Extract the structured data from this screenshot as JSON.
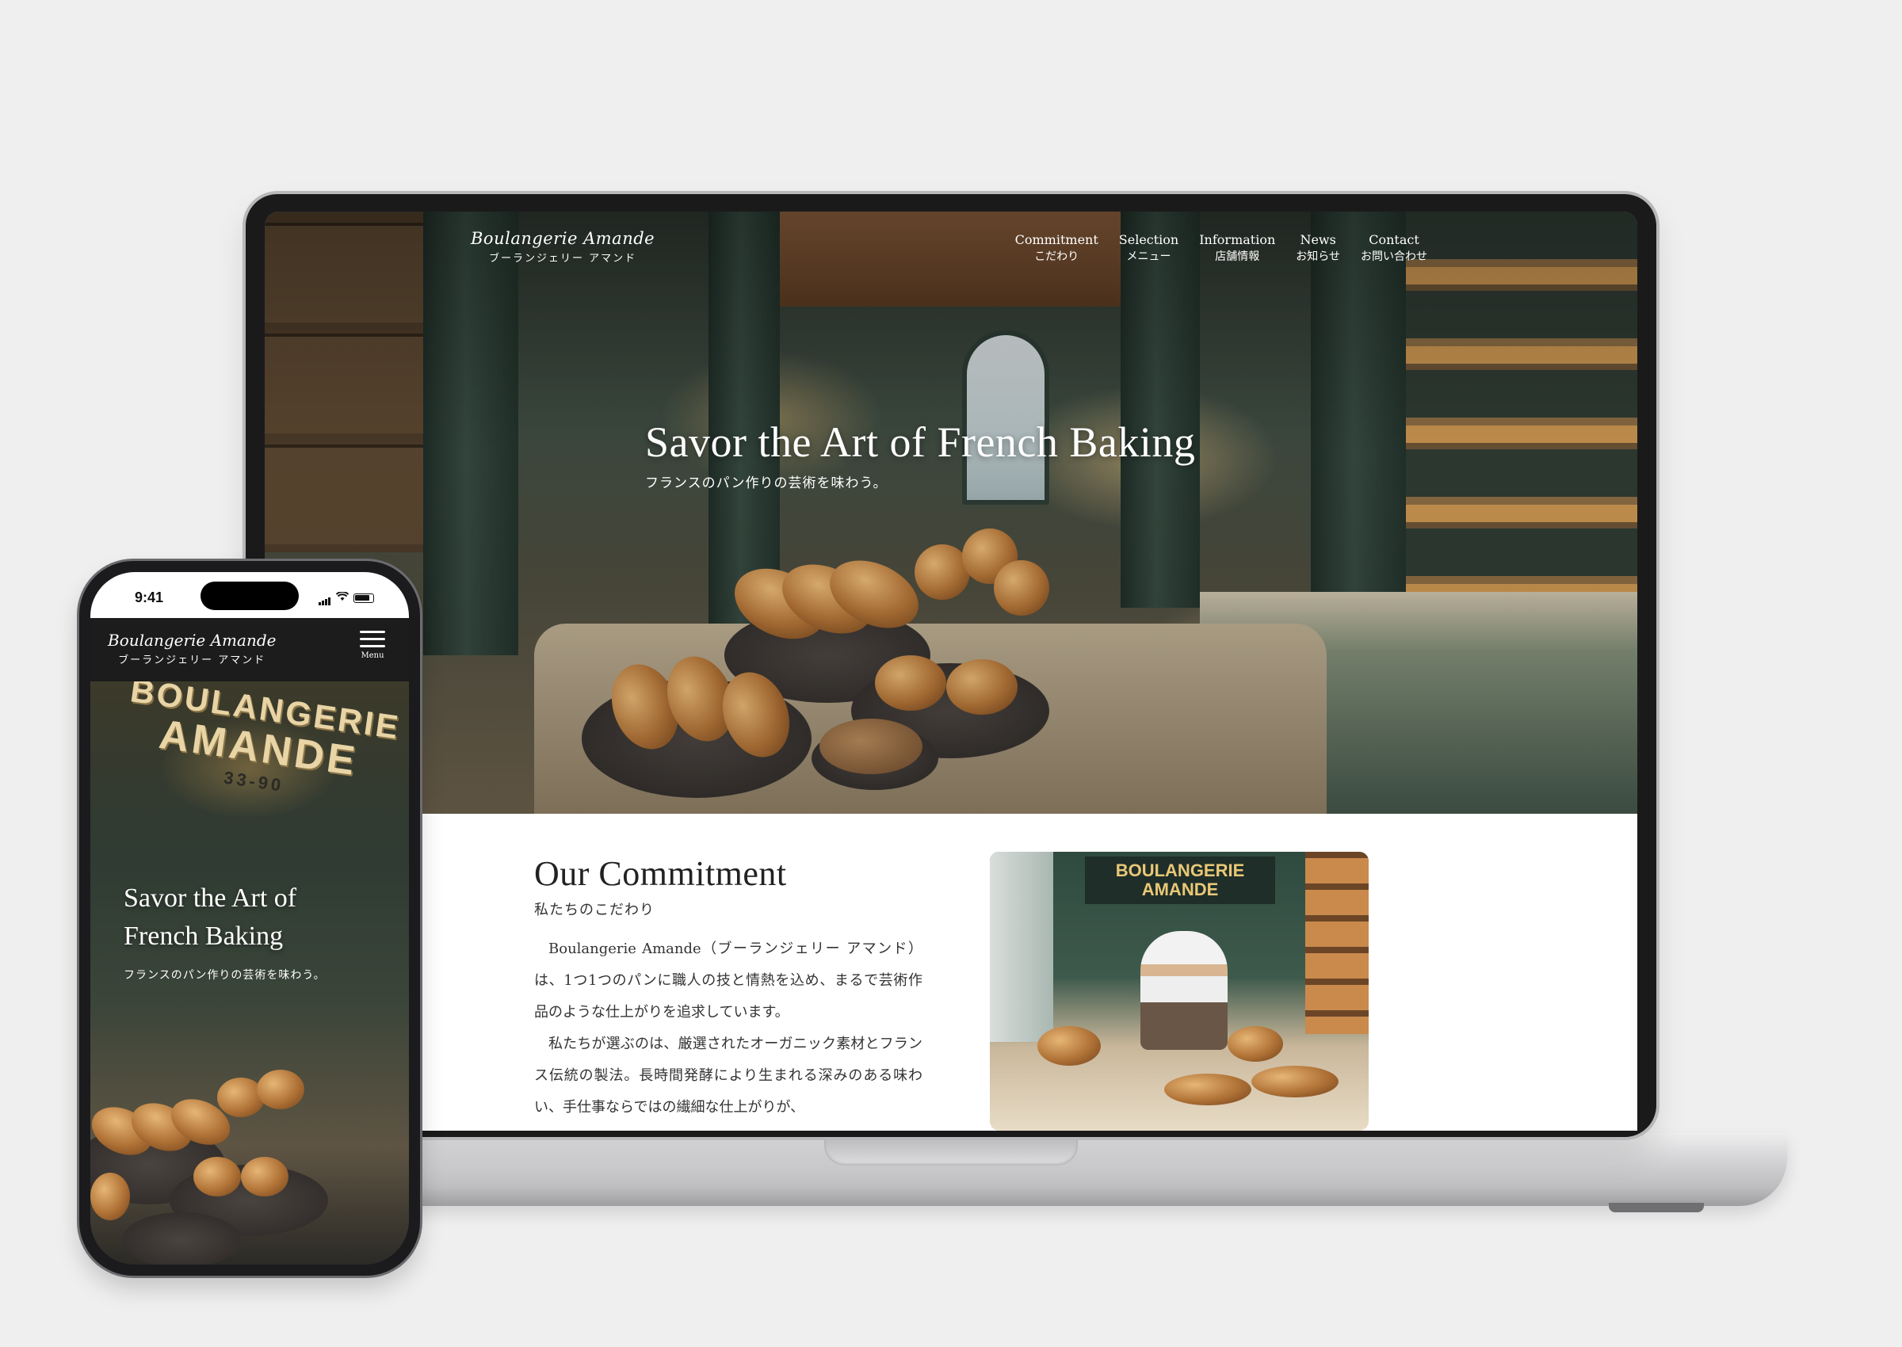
{
  "desktop": {
    "logo": {
      "script": "Boulangerie Amande",
      "kana": "ブーランジェリー アマンド"
    },
    "nav": [
      {
        "en": "Commitment",
        "jp": "こだわり"
      },
      {
        "en": "Selection",
        "jp": "メニュー"
      },
      {
        "en": "Information",
        "jp": "店舗情報"
      },
      {
        "en": "News",
        "jp": "お知らせ"
      },
      {
        "en": "Contact",
        "jp": "お問い合わせ"
      }
    ],
    "hero": {
      "title": "Savor the Art of French Baking",
      "subtitle": "フランスのパン作りの芸術を味わう。"
    },
    "commitment": {
      "title": "Our Commitment",
      "subtitle": "私たちのこだわり",
      "paragraphs": [
        "Boulangerie Amande（ブーランジェリー アマンド）は、1つ1つのパンに職人の技と情熱を込め、まるで芸術作品のような仕上がりを追求しています。",
        "私たちが選ぶのは、厳選されたオーガニック素材とフランス伝統の製法。長時間発酵により生まれる深みのある味わい、手仕事ならではの繊細な仕上がりが、"
      ],
      "image_sign": {
        "line1": "BOULANGERIE",
        "line2": "AMANDE"
      }
    }
  },
  "mobile": {
    "status": {
      "time": "9:41"
    },
    "logo": {
      "script": "Boulangerie Amande",
      "kana": "ブーランジェリー アマンド"
    },
    "menu_label": "Menu",
    "storefront_sign": {
      "line1": "BOULANGERIE",
      "line2": "AMANDE",
      "line3": "33-90"
    },
    "hero": {
      "title_line1": "Savor the Art of",
      "title_line2": "French Baking",
      "subtitle": "フランスのパン作りの芸術を味わう。"
    }
  }
}
